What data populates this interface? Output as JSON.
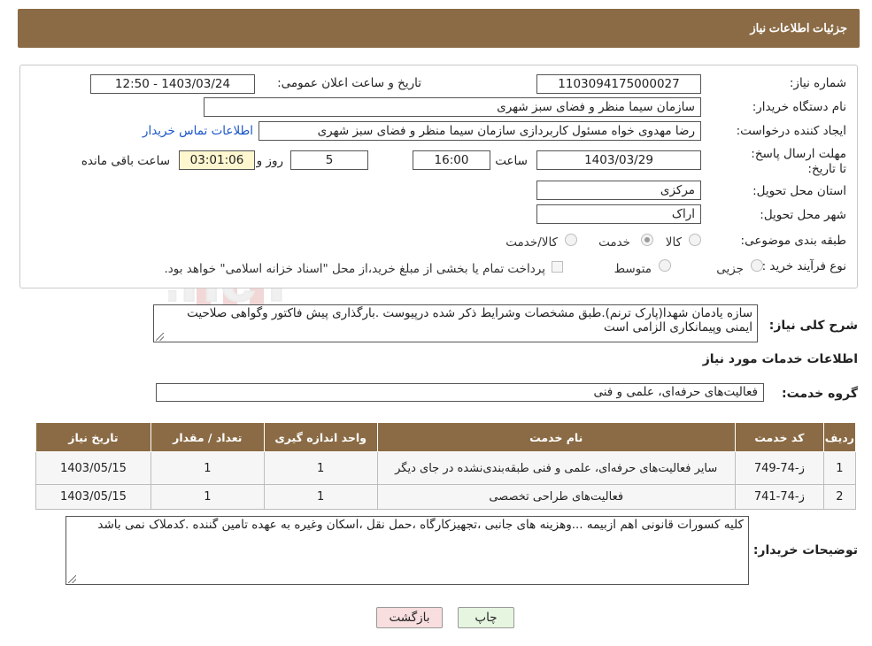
{
  "header": {
    "title": "جزئیات اطلاعات نیاز"
  },
  "watermark": {
    "text": "AriaTender.neT"
  },
  "form": {
    "need_number_label": "شماره نیاز:",
    "need_number": "1103094175000027",
    "announce_label": "تاریخ و ساعت اعلان عمومی:",
    "announce_value": "1403/03/24 - 12:50",
    "buyer_org_label": "نام دستگاه خریدار:",
    "buyer_org": "سازمان سیما منظر و فضای سبز شهری",
    "creator_label": "ایجاد کننده درخواست:",
    "creator": "رضا مهدوی خواه مسئول کاربردازی سازمان سیما منظر و فضای سبز شهری",
    "contact_link": "اطلاعات تماس خریدار",
    "deadline_label": "مهلت ارسال پاسخ: تا تاریخ:",
    "deadline_date": "1403/03/29",
    "time_label": "ساعت",
    "deadline_time": "16:00",
    "days_value": "5",
    "days_label": "روز و",
    "remaining_value": "03:01:06",
    "remaining_label": "ساعت باقی مانده",
    "province_label": "استان محل تحویل:",
    "province": "مرکزی",
    "city_label": "شهر محل تحویل:",
    "city": "اراک",
    "category_label": "طبقه بندی موضوعی:",
    "category_options": [
      "کالا",
      "خدمت",
      "کالا/خدمت"
    ],
    "category_selected": "خدمت",
    "process_label": "نوع فرآیند خرید :",
    "process_options": [
      "جزیی",
      "متوسط"
    ],
    "payment_note": "پرداخت تمام یا بخشی از مبلغ خرید،از محل \"اسناد خزانه اسلامی\" خواهد بود."
  },
  "description": {
    "label": "شرح کلی نیاز:",
    "text": "سازه یادمان شهدا(پارک ترنم).طبق مشخصات وشرایط ذکر شده درپیوست .بارگذاری پیش فاکتور وگواهی صلاحیت ایمنی وپیمانکاری الزامی است"
  },
  "services_section": {
    "title": "اطلاعات خدمات مورد نیاز",
    "group_label": "گروه خدمت:",
    "group_value": "فعالیت‌های حرفه‌ای، علمی و فنی"
  },
  "table": {
    "headers": [
      "ردیف",
      "کد خدمت",
      "نام خدمت",
      "واحد اندازه گیری",
      "تعداد / مقدار",
      "تاریخ نیاز"
    ],
    "rows": [
      [
        "1",
        "ز-74-749",
        "سایر فعالیت‌های حرفه‌ای، علمی و فنی طبقه‌بندی‌نشده در جای دیگر",
        "1",
        "1",
        "1403/05/15"
      ],
      [
        "2",
        "ز-74-741",
        "فعالیت‌های طراحی تخصصی",
        "1",
        "1",
        "1403/05/15"
      ]
    ]
  },
  "buyer_notes": {
    "label": "توضیحات خریدار:",
    "text": "کلیه کسورات قانونی اهم ازبیمه ...وهزینه های جانبی ،تجهیزکارگاه ،حمل نقل ،اسکان وغیره به عهده تامین گننده .کدملاک نمی باشد"
  },
  "buttons": {
    "print": "چاپ",
    "back": "بازگشت"
  },
  "colors": {
    "header_bg": "#8b6b45",
    "link": "#1a55c8",
    "back_btn": "#f8dede",
    "print_btn": "#e6f5e0"
  }
}
